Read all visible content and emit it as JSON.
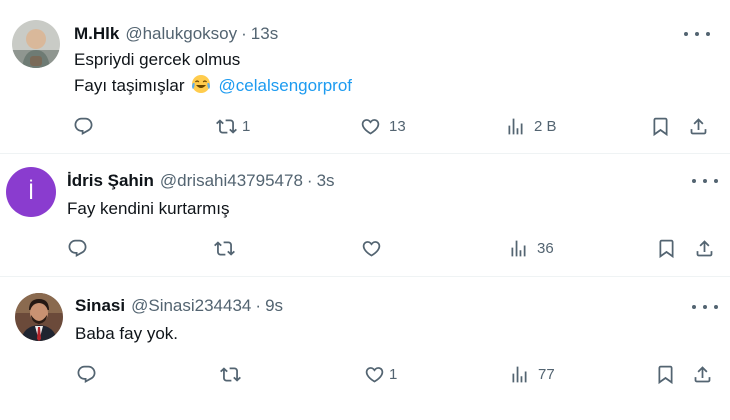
{
  "tweets": [
    {
      "name": "M.Hlk",
      "handle": "@halukgoksoy",
      "separator": "·",
      "time": "13s",
      "line1": "Espriydi gercek olmus",
      "line2": "Fayı taşimışlar",
      "emoji": "face-with-tears-of-joy",
      "mention": "@celalsengorprof",
      "replies": "",
      "retweets": "1",
      "likes": "13",
      "views": "2 B"
    },
    {
      "name": "İdris Şahin",
      "handle": "@drisahi43795478",
      "separator": "·",
      "time": "3s",
      "avatar_letter": "İ",
      "avatar_color": "#8a3ccf",
      "line1": "Fay kendini kurtarmış",
      "replies": "",
      "retweets": "",
      "likes": "",
      "views": "36"
    },
    {
      "name": "Sinasi",
      "handle": "@Sinasi234434",
      "separator": "·",
      "time": "9s",
      "line1": "Baba fay yok.",
      "replies": "",
      "retweets": "",
      "likes": "1",
      "views": "77"
    }
  ],
  "colors": {
    "text": "#0f1419",
    "secondary": "#536471",
    "mention": "#1d9bf0",
    "divider": "#eff3f4"
  }
}
